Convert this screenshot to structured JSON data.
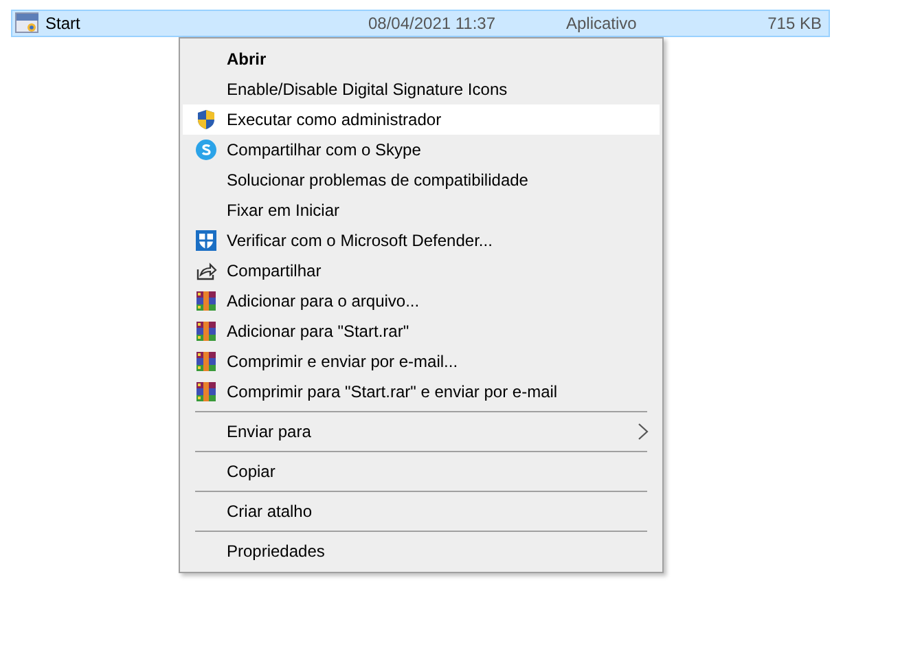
{
  "file_row": {
    "name": "Start",
    "date": "08/04/2021 11:37",
    "type": "Aplicativo",
    "size": "715 KB",
    "selected": true
  },
  "context_menu": {
    "items": [
      {
        "kind": "plain",
        "label": "Abrir",
        "default": true,
        "selected": false
      },
      {
        "kind": "plain",
        "label": "Enable/Disable Digital Signature Icons",
        "default": false,
        "selected": false
      },
      {
        "kind": "admin",
        "label": "Executar como administrador",
        "default": false,
        "selected": true
      },
      {
        "kind": "skype",
        "label": "Compartilhar com o Skype",
        "default": false,
        "selected": false
      },
      {
        "kind": "plain",
        "label": "Solucionar problemas de compatibilidade",
        "default": false,
        "selected": false
      },
      {
        "kind": "plain",
        "label": "Fixar em Iniciar",
        "default": false,
        "selected": false
      },
      {
        "kind": "defender",
        "label": "Verificar com o Microsoft Defender...",
        "default": false,
        "selected": false
      },
      {
        "kind": "share",
        "label": "Compartilhar",
        "default": false,
        "selected": false
      },
      {
        "kind": "archive",
        "label": "Adicionar para o arquivo...",
        "default": false,
        "selected": false
      },
      {
        "kind": "archive",
        "label": "Adicionar para \"Start.rar\"",
        "default": false,
        "selected": false
      },
      {
        "kind": "archive",
        "label": "Comprimir e enviar por e-mail...",
        "default": false,
        "selected": false
      },
      {
        "kind": "archive",
        "label": "Comprimir para \"Start.rar\" e enviar por e-mail",
        "default": false,
        "selected": false
      },
      {
        "kind": "separator"
      },
      {
        "kind": "submenu",
        "label": "Enviar para",
        "default": false,
        "selected": false
      },
      {
        "kind": "separator"
      },
      {
        "kind": "plain",
        "label": "Copiar",
        "default": false,
        "selected": false
      },
      {
        "kind": "separator"
      },
      {
        "kind": "plain",
        "label": "Criar atalho",
        "default": false,
        "selected": false
      },
      {
        "kind": "separator"
      },
      {
        "kind": "plain",
        "label": "Propriedades",
        "default": false,
        "selected": false
      }
    ]
  }
}
